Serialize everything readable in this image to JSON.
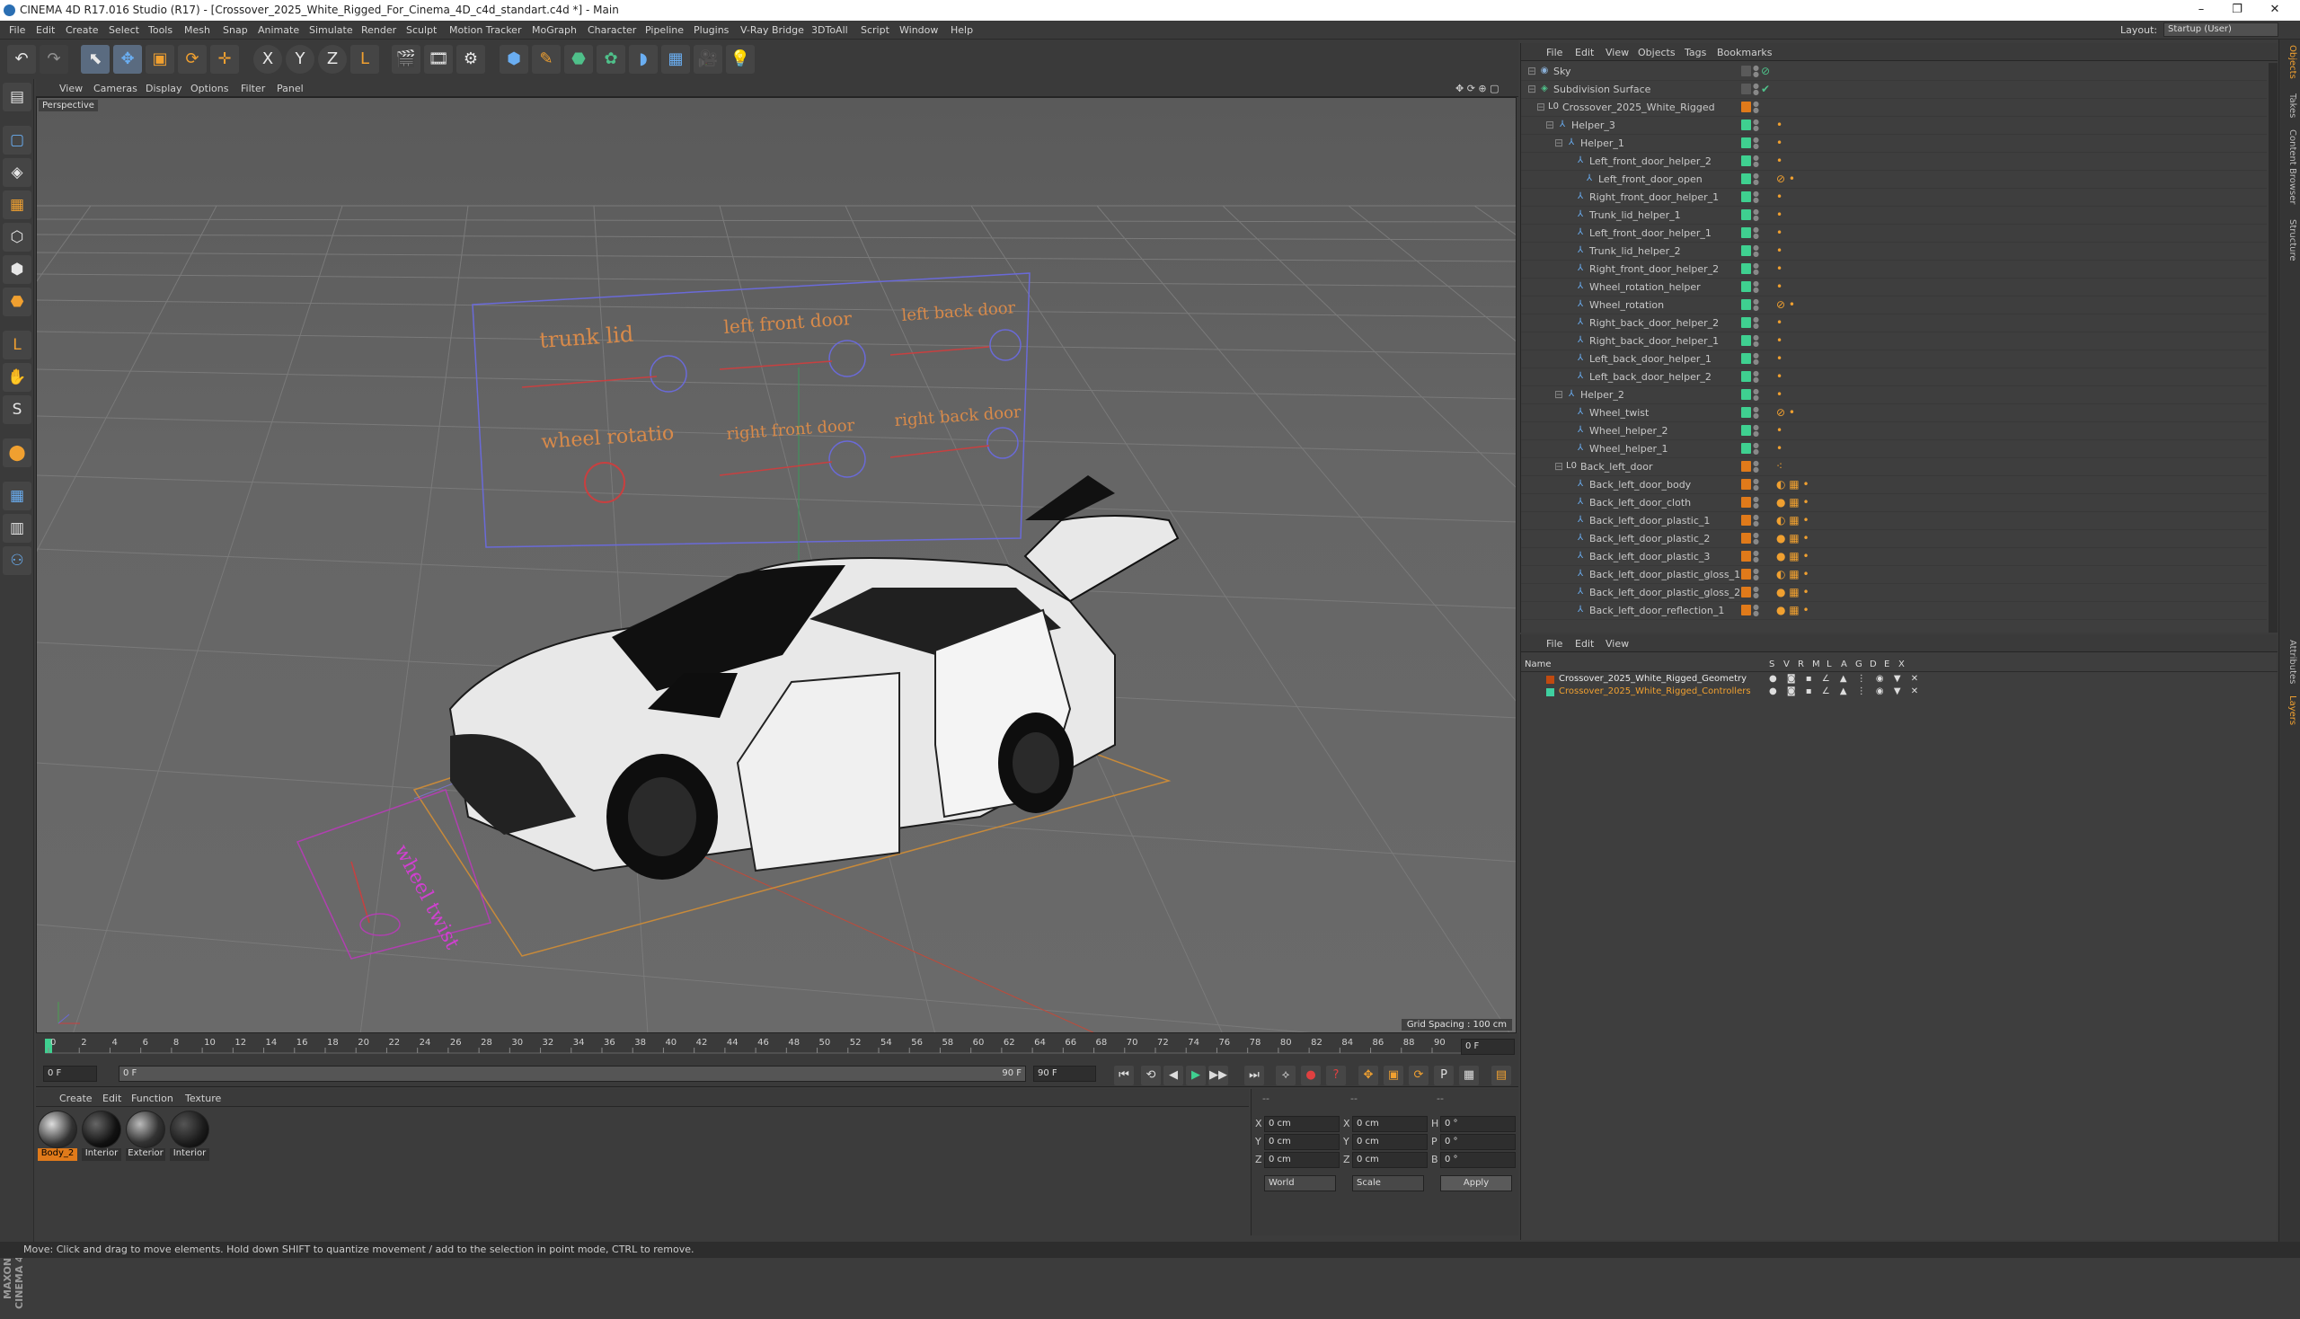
{
  "title_bar": {
    "title": "CINEMA 4D R17.016 Studio (R17) - [Crossover_2025_White_Rigged_For_Cinema_4D_c4d_standart.c4d *] - Main",
    "minimize": "–",
    "maximize": "❐",
    "close": "✕"
  },
  "menu": [
    "File",
    "Edit",
    "Create",
    "Select",
    "Tools",
    "Mesh",
    "Snap",
    "Animate",
    "Simulate",
    "Render",
    "Sculpt",
    "Motion Tracker",
    "MoGraph",
    "Character",
    "Pipeline",
    "Plugins",
    "V-Ray Bridge",
    "3DToAll",
    "Script",
    "Window",
    "Help"
  ],
  "layout": {
    "label": "Layout:",
    "value": "Startup (User)"
  },
  "toolbar": {
    "undo": "↶",
    "redo": "↷",
    "tools": [
      "⬉",
      "✥",
      "▣",
      "⟳",
      "✛"
    ],
    "axes": [
      "X",
      "Y",
      "Z"
    ],
    "coord": "L",
    "render": [
      "🎬",
      "🎞",
      "⚙"
    ],
    "objects": [
      "⬢",
      "✎",
      "⬣",
      "✿",
      "◗",
      "▦",
      "🎥",
      "💡"
    ]
  },
  "left_tools": [
    "▤",
    "▢",
    "◈",
    "▦",
    "⬡",
    "⬢",
    "⬣",
    "L",
    "✋",
    "S",
    "⬤",
    "▦",
    "▥",
    "⚇"
  ],
  "viewport": {
    "menu": [
      "View",
      "Cameras",
      "Display",
      "Options",
      "Filter",
      "Panel"
    ],
    "nav_icons": "✥ ⟳ ⊕ ▢",
    "label": "Perspective",
    "grid_spacing": "Grid Spacing : 100 cm",
    "controller_labels": {
      "trunk_lid": "trunk lid",
      "left_front_door": "left front door",
      "left_back_door": "left back door",
      "wheel_rotatio": "wheel rotatio",
      "right_front_door": "right front door",
      "right_back_door": "right back door",
      "wheel_twist": "wheel twist"
    }
  },
  "timeline": {
    "ticks": [
      "0",
      "2",
      "4",
      "6",
      "8",
      "10",
      "12",
      "14",
      "16",
      "18",
      "20",
      "22",
      "24",
      "26",
      "28",
      "30",
      "32",
      "34",
      "36",
      "38",
      "40",
      "42",
      "44",
      "46",
      "48",
      "50",
      "52",
      "54",
      "56",
      "58",
      "60",
      "62",
      "64",
      "66",
      "68",
      "70",
      "72",
      "74",
      "76",
      "78",
      "80",
      "82",
      "84",
      "86",
      "88",
      "90"
    ],
    "current": "0 F"
  },
  "playback": {
    "start": "0 F",
    "min": "0 F",
    "max": "90 F",
    "end": "90 F",
    "buttons": [
      "⏮",
      "⟲",
      "◀",
      "▶",
      "▶▶",
      "⏭"
    ],
    "record": [
      "⟡",
      "●",
      "?",
      "✥",
      "▣",
      "⟳",
      "P",
      "▦",
      "▤"
    ]
  },
  "materials": {
    "menu": [
      "Create",
      "Edit",
      "Function",
      "Texture"
    ],
    "items": [
      {
        "name": "Body_2"
      },
      {
        "name": "Interior"
      },
      {
        "name": "Exterior"
      },
      {
        "name": "Interior"
      }
    ]
  },
  "coordinates": {
    "header": [
      "--",
      "--",
      "--"
    ],
    "rows": [
      {
        "axis": "X",
        "pos": "0 cm",
        "axis2": "X",
        "size": "0 cm",
        "rlabel": "H",
        "rot": "0 °"
      },
      {
        "axis": "Y",
        "pos": "0 cm",
        "axis2": "Y",
        "size": "0 cm",
        "rlabel": "P",
        "rot": "0 °"
      },
      {
        "axis": "Z",
        "pos": "0 cm",
        "axis2": "Z",
        "size": "0 cm",
        "rlabel": "B",
        "rot": "0 °"
      }
    ],
    "mode1": "World",
    "mode2": "Scale",
    "apply": "Apply"
  },
  "object_manager": {
    "menu": [
      "File",
      "Edit",
      "View",
      "Objects",
      "Tags",
      "Bookmarks"
    ],
    "objects": [
      {
        "name": "Sky",
        "depth": 0,
        "icon": "◉",
        "icolor": "#8ab0d8",
        "color": "#5a5a5a",
        "check": "⊘",
        "tags": ""
      },
      {
        "name": "Subdivision Surface",
        "depth": 0,
        "icon": "◈",
        "icolor": "#4fc08a",
        "color": "#5a5a5a",
        "check": "✔",
        "tags": ""
      },
      {
        "name": "Crossover_2025_White_Rigged",
        "depth": 1,
        "icon": "L0",
        "icolor": "#cfcfcf",
        "color": "#e07a1a",
        "check": "",
        "tags": ""
      },
      {
        "name": "Helper_3",
        "depth": 2,
        "icon": "⅄",
        "icolor": "#6aaef2",
        "color": "#3fd090",
        "check": "",
        "tags": "•"
      },
      {
        "name": "Helper_1",
        "depth": 3,
        "icon": "⅄",
        "icolor": "#6aaef2",
        "color": "#3fd090",
        "check": "",
        "tags": "•"
      },
      {
        "name": "Left_front_door_helper_2",
        "depth": 4,
        "icon": "⅄",
        "icolor": "#6aaef2",
        "color": "#3fd090",
        "check": "",
        "tags": "•"
      },
      {
        "name": "Left_front_door_open",
        "depth": 5,
        "icon": "⅄",
        "icolor": "#6aaef2",
        "color": "#3fd090",
        "check": "",
        "tags": "⊘ •"
      },
      {
        "name": "Right_front_door_helper_1",
        "depth": 4,
        "icon": "⅄",
        "icolor": "#6aaef2",
        "color": "#3fd090",
        "check": "",
        "tags": "•"
      },
      {
        "name": "Trunk_lid_helper_1",
        "depth": 4,
        "icon": "⅄",
        "icolor": "#6aaef2",
        "color": "#3fd090",
        "check": "",
        "tags": "•"
      },
      {
        "name": "Left_front_door_helper_1",
        "depth": 4,
        "icon": "⅄",
        "icolor": "#6aaef2",
        "color": "#3fd090",
        "check": "",
        "tags": "•"
      },
      {
        "name": "Trunk_lid_helper_2",
        "depth": 4,
        "icon": "⅄",
        "icolor": "#6aaef2",
        "color": "#3fd090",
        "check": "",
        "tags": "•"
      },
      {
        "name": "Right_front_door_helper_2",
        "depth": 4,
        "icon": "⅄",
        "icolor": "#6aaef2",
        "color": "#3fd090",
        "check": "",
        "tags": "•"
      },
      {
        "name": "Wheel_rotation_helper",
        "depth": 4,
        "icon": "⅄",
        "icolor": "#6aaef2",
        "color": "#3fd090",
        "check": "",
        "tags": "•"
      },
      {
        "name": "Wheel_rotation",
        "depth": 4,
        "icon": "⅄",
        "icolor": "#6aaef2",
        "color": "#3fd090",
        "check": "",
        "tags": "⊘ •"
      },
      {
        "name": "Right_back_door_helper_2",
        "depth": 4,
        "icon": "⅄",
        "icolor": "#6aaef2",
        "color": "#3fd090",
        "check": "",
        "tags": "•"
      },
      {
        "name": "Right_back_door_helper_1",
        "depth": 4,
        "icon": "⅄",
        "icolor": "#6aaef2",
        "color": "#3fd090",
        "check": "",
        "tags": "•"
      },
      {
        "name": "Left_back_door_helper_1",
        "depth": 4,
        "icon": "⅄",
        "icolor": "#6aaef2",
        "color": "#3fd090",
        "check": "",
        "tags": "•"
      },
      {
        "name": "Left_back_door_helper_2",
        "depth": 4,
        "icon": "⅄",
        "icolor": "#6aaef2",
        "color": "#3fd090",
        "check": "",
        "tags": "•"
      },
      {
        "name": "Helper_2",
        "depth": 3,
        "icon": "⅄",
        "icolor": "#6aaef2",
        "color": "#3fd090",
        "check": "",
        "tags": "•"
      },
      {
        "name": "Wheel_twist",
        "depth": 4,
        "icon": "⅄",
        "icolor": "#6aaef2",
        "color": "#3fd090",
        "check": "",
        "tags": "⊘ •"
      },
      {
        "name": "Wheel_helper_2",
        "depth": 4,
        "icon": "⅄",
        "icolor": "#6aaef2",
        "color": "#3fd090",
        "check": "",
        "tags": "•"
      },
      {
        "name": "Wheel_helper_1",
        "depth": 4,
        "icon": "⅄",
        "icolor": "#6aaef2",
        "color": "#3fd090",
        "check": "",
        "tags": "•"
      },
      {
        "name": "Back_left_door",
        "depth": 3,
        "icon": "L0",
        "icolor": "#cfcfcf",
        "color": "#e07a1a",
        "check": "",
        "tags": "⁖"
      },
      {
        "name": "Back_left_door_body",
        "depth": 4,
        "icon": "⅄",
        "icolor": "#6aaef2",
        "color": "#e07a1a",
        "check": "",
        "tags": "◐ ▦ •"
      },
      {
        "name": "Back_left_door_cloth",
        "depth": 4,
        "icon": "⅄",
        "icolor": "#6aaef2",
        "color": "#e07a1a",
        "check": "",
        "tags": "● ▦ •"
      },
      {
        "name": "Back_left_door_plastic_1",
        "depth": 4,
        "icon": "⅄",
        "icolor": "#6aaef2",
        "color": "#e07a1a",
        "check": "",
        "tags": "◐ ▦ •"
      },
      {
        "name": "Back_left_door_plastic_2",
        "depth": 4,
        "icon": "⅄",
        "icolor": "#6aaef2",
        "color": "#e07a1a",
        "check": "",
        "tags": "● ▦ •"
      },
      {
        "name": "Back_left_door_plastic_3",
        "depth": 4,
        "icon": "⅄",
        "icolor": "#6aaef2",
        "color": "#e07a1a",
        "check": "",
        "tags": "● ▦ •"
      },
      {
        "name": "Back_left_door_plastic_gloss_1",
        "depth": 4,
        "icon": "⅄",
        "icolor": "#6aaef2",
        "color": "#e07a1a",
        "check": "",
        "tags": "◐ ▦ •"
      },
      {
        "name": "Back_left_door_plastic_gloss_2",
        "depth": 4,
        "icon": "⅄",
        "icolor": "#6aaef2",
        "color": "#e07a1a",
        "check": "",
        "tags": "● ▦ •"
      },
      {
        "name": "Back_left_door_reflection_1",
        "depth": 4,
        "icon": "⅄",
        "icolor": "#6aaef2",
        "color": "#e07a1a",
        "check": "",
        "tags": "● ▦ •"
      }
    ]
  },
  "layer_manager": {
    "menu": [
      "File",
      "Edit",
      "View"
    ],
    "columns": [
      "Name",
      "S",
      "V",
      "R",
      "M",
      "L",
      "A",
      "G",
      "D",
      "E",
      "X"
    ],
    "layers": [
      {
        "name": "Crossover_2025_White_Rigged_Geometry",
        "color": "#c04a10",
        "text_color": "#e8e8e8"
      },
      {
        "name": "Crossover_2025_White_Rigged_Controllers",
        "color": "#3fd0a0",
        "text_color": "#f0a030"
      }
    ],
    "flags": "● ◙ ▪ ∠ ▲ ⋮ ◉ ▼ ✕"
  },
  "right_tabs": [
    {
      "label": "Objects",
      "active": true
    },
    {
      "label": "Takes",
      "active": false
    },
    {
      "label": "Content Browser",
      "active": false
    },
    {
      "label": "Structure",
      "active": false
    },
    {
      "label": "Attributes",
      "active": false
    },
    {
      "label": "Layers",
      "active": true
    }
  ],
  "status": "Move: Click and drag to move elements. Hold down SHIFT to quantize movement / add to the selection in point mode, CTRL to remove."
}
